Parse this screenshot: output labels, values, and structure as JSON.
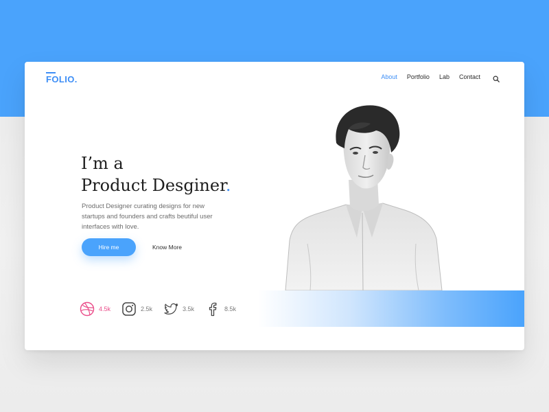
{
  "header": {
    "logo_text": "FOLIO.",
    "nav": [
      {
        "label": "About",
        "active": true
      },
      {
        "label": "Portfolio",
        "active": false
      },
      {
        "label": "Lab",
        "active": false
      },
      {
        "label": "Contact",
        "active": false
      }
    ],
    "search_icon": "search-icon"
  },
  "hero": {
    "line1": "I’m a",
    "line2": "Product Desginer",
    "dot": ".",
    "description": "Product Designer curating designs for new startups and founders and crafts beutiful user interfaces with love.",
    "primary_button": "Hire me",
    "secondary_button": "Know More"
  },
  "social": [
    {
      "network": "dribbble",
      "icon": "dribbble-icon",
      "count": "4.5k"
    },
    {
      "network": "instagram",
      "icon": "instagram-icon",
      "count": "2.5k"
    },
    {
      "network": "twitter",
      "icon": "twitter-icon",
      "count": "3.5k"
    },
    {
      "network": "facebook",
      "icon": "facebook-icon",
      "count": "8.5k"
    }
  ],
  "colors": {
    "accent": "#4aa3fc",
    "dribbble": "#ea4c89",
    "text": "#1d1d1d"
  }
}
